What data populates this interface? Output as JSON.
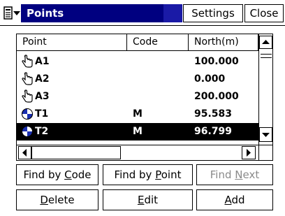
{
  "titlebar": {
    "title": "Points",
    "settings_label": "Settings",
    "close_label": "Close",
    "menu_icon": "menu-dropdown-icon"
  },
  "list": {
    "columns": [
      "Point",
      "Code",
      "North(m)"
    ],
    "rows": [
      {
        "icon": "hand-pointer-icon",
        "point": "A1",
        "code": "",
        "north": "100.000",
        "selected": false
      },
      {
        "icon": "hand-pointer-icon",
        "point": "A2",
        "code": "",
        "north": "0.000",
        "selected": false
      },
      {
        "icon": "hand-pointer-icon",
        "point": "A3",
        "code": "",
        "north": "200.000",
        "selected": false
      },
      {
        "icon": "survey-target-icon",
        "point": "T1",
        "code": "M",
        "north": "95.583",
        "selected": false
      },
      {
        "icon": "survey-target-icon",
        "point": "T2",
        "code": "M",
        "north": "96.799",
        "selected": true
      }
    ]
  },
  "buttons": {
    "find_code": {
      "pre": "Find by ",
      "key": "C",
      "post": "ode"
    },
    "find_point": {
      "pre": "Find by ",
      "key": "P",
      "post": "oint"
    },
    "find_next": {
      "pre": "Find ",
      "key": "N",
      "post": "ext"
    },
    "delete": {
      "pre": "",
      "key": "D",
      "post": "elete"
    },
    "edit": {
      "pre": "",
      "key": "E",
      "post": "dit"
    },
    "add": {
      "pre": "",
      "key": "A",
      "post": "dd"
    }
  },
  "colors": {
    "title_bg": "#000080",
    "selection_bg": "#000000",
    "disabled_text": "#8a8a8a"
  }
}
